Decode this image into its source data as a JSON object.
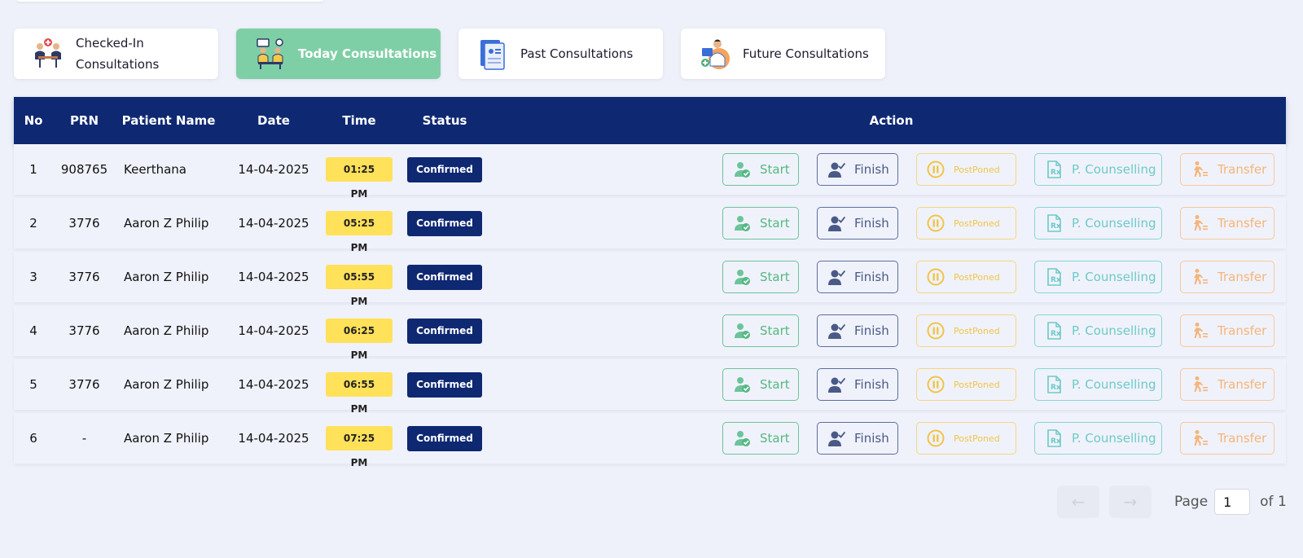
{
  "tabs": [
    {
      "label": "Checked-In Consultations",
      "icon": "checked-in-icon",
      "active": false
    },
    {
      "label": "Today Consultations",
      "icon": "today-consultation-icon",
      "active": true
    },
    {
      "label": "Past Consultations",
      "icon": "past-consultation-icon",
      "active": false
    },
    {
      "label": "Future Consultations",
      "icon": "future-consultation-icon",
      "active": false
    }
  ],
  "table": {
    "headers": {
      "no": "No",
      "prn": "PRN",
      "name": "Patient Name",
      "date": "Date",
      "time": "Time",
      "status": "Status",
      "action": "Action"
    },
    "rows": [
      {
        "no": "1",
        "prn": "908765",
        "name": "Keerthana",
        "date": "14-04-2025",
        "time": "01:25 PM",
        "status": "Confirmed"
      },
      {
        "no": "2",
        "prn": "3776",
        "name": "Aaron Z Philip",
        "date": "14-04-2025",
        "time": "05:25 PM",
        "status": "Confirmed"
      },
      {
        "no": "3",
        "prn": "3776",
        "name": "Aaron Z Philip",
        "date": "14-04-2025",
        "time": "05:55 PM",
        "status": "Confirmed"
      },
      {
        "no": "4",
        "prn": "3776",
        "name": "Aaron Z Philip",
        "date": "14-04-2025",
        "time": "06:25 PM",
        "status": "Confirmed"
      },
      {
        "no": "5",
        "prn": "3776",
        "name": "Aaron Z Philip",
        "date": "14-04-2025",
        "time": "06:55 PM",
        "status": "Confirmed"
      },
      {
        "no": "6",
        "prn": "-",
        "name": "Aaron Z Philip",
        "date": "14-04-2025",
        "time": "07:25 PM",
        "status": "Confirmed"
      }
    ]
  },
  "actions": {
    "start": "Start",
    "finish": "Finish",
    "postponed": "PostPoned",
    "counselling": "P. Counselling",
    "transfer": "Transfer"
  },
  "pagination": {
    "prev": "←",
    "next": "→",
    "page_label": "Page",
    "current": "1",
    "of_label": "of 1"
  },
  "colors": {
    "header_bg": "#0e2872",
    "active_tab": "#7fcfa6",
    "time_chip": "#ffe15a",
    "status_chip": "#0e2872"
  }
}
